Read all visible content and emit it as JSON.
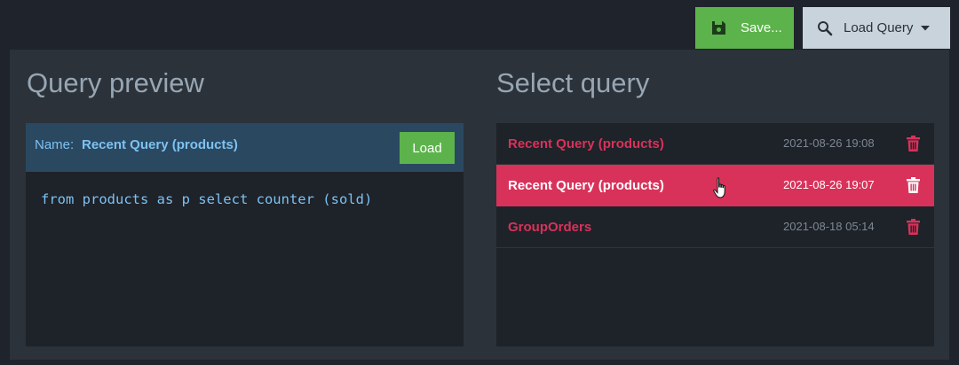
{
  "toolbar": {
    "save_label": "Save...",
    "load_query_label": "Load Query"
  },
  "preview": {
    "title": "Query preview",
    "name_label": "Name:",
    "name_value": "Recent Query (products)",
    "load_label": "Load",
    "query_text": "from products as p select counter (sold)"
  },
  "select": {
    "title": "Select query",
    "items": [
      {
        "name": "Recent Query (products)",
        "date": "2021-08-26 19:08",
        "selected": false
      },
      {
        "name": "Recent Query (products)",
        "date": "2021-08-26 19:07",
        "selected": true
      },
      {
        "name": "GroupOrders",
        "date": "2021-08-18 05:14",
        "selected": false
      }
    ]
  },
  "icons": {
    "save": "floppy-disk-icon",
    "search": "magnifier-icon",
    "caret": "caret-down-icon",
    "delete": "trash-icon",
    "cursor": "hand-pointer-icon"
  },
  "colors": {
    "accent_green": "#5cb34b",
    "accent_red": "#d8325a",
    "link_blue": "#7cc2f2"
  }
}
